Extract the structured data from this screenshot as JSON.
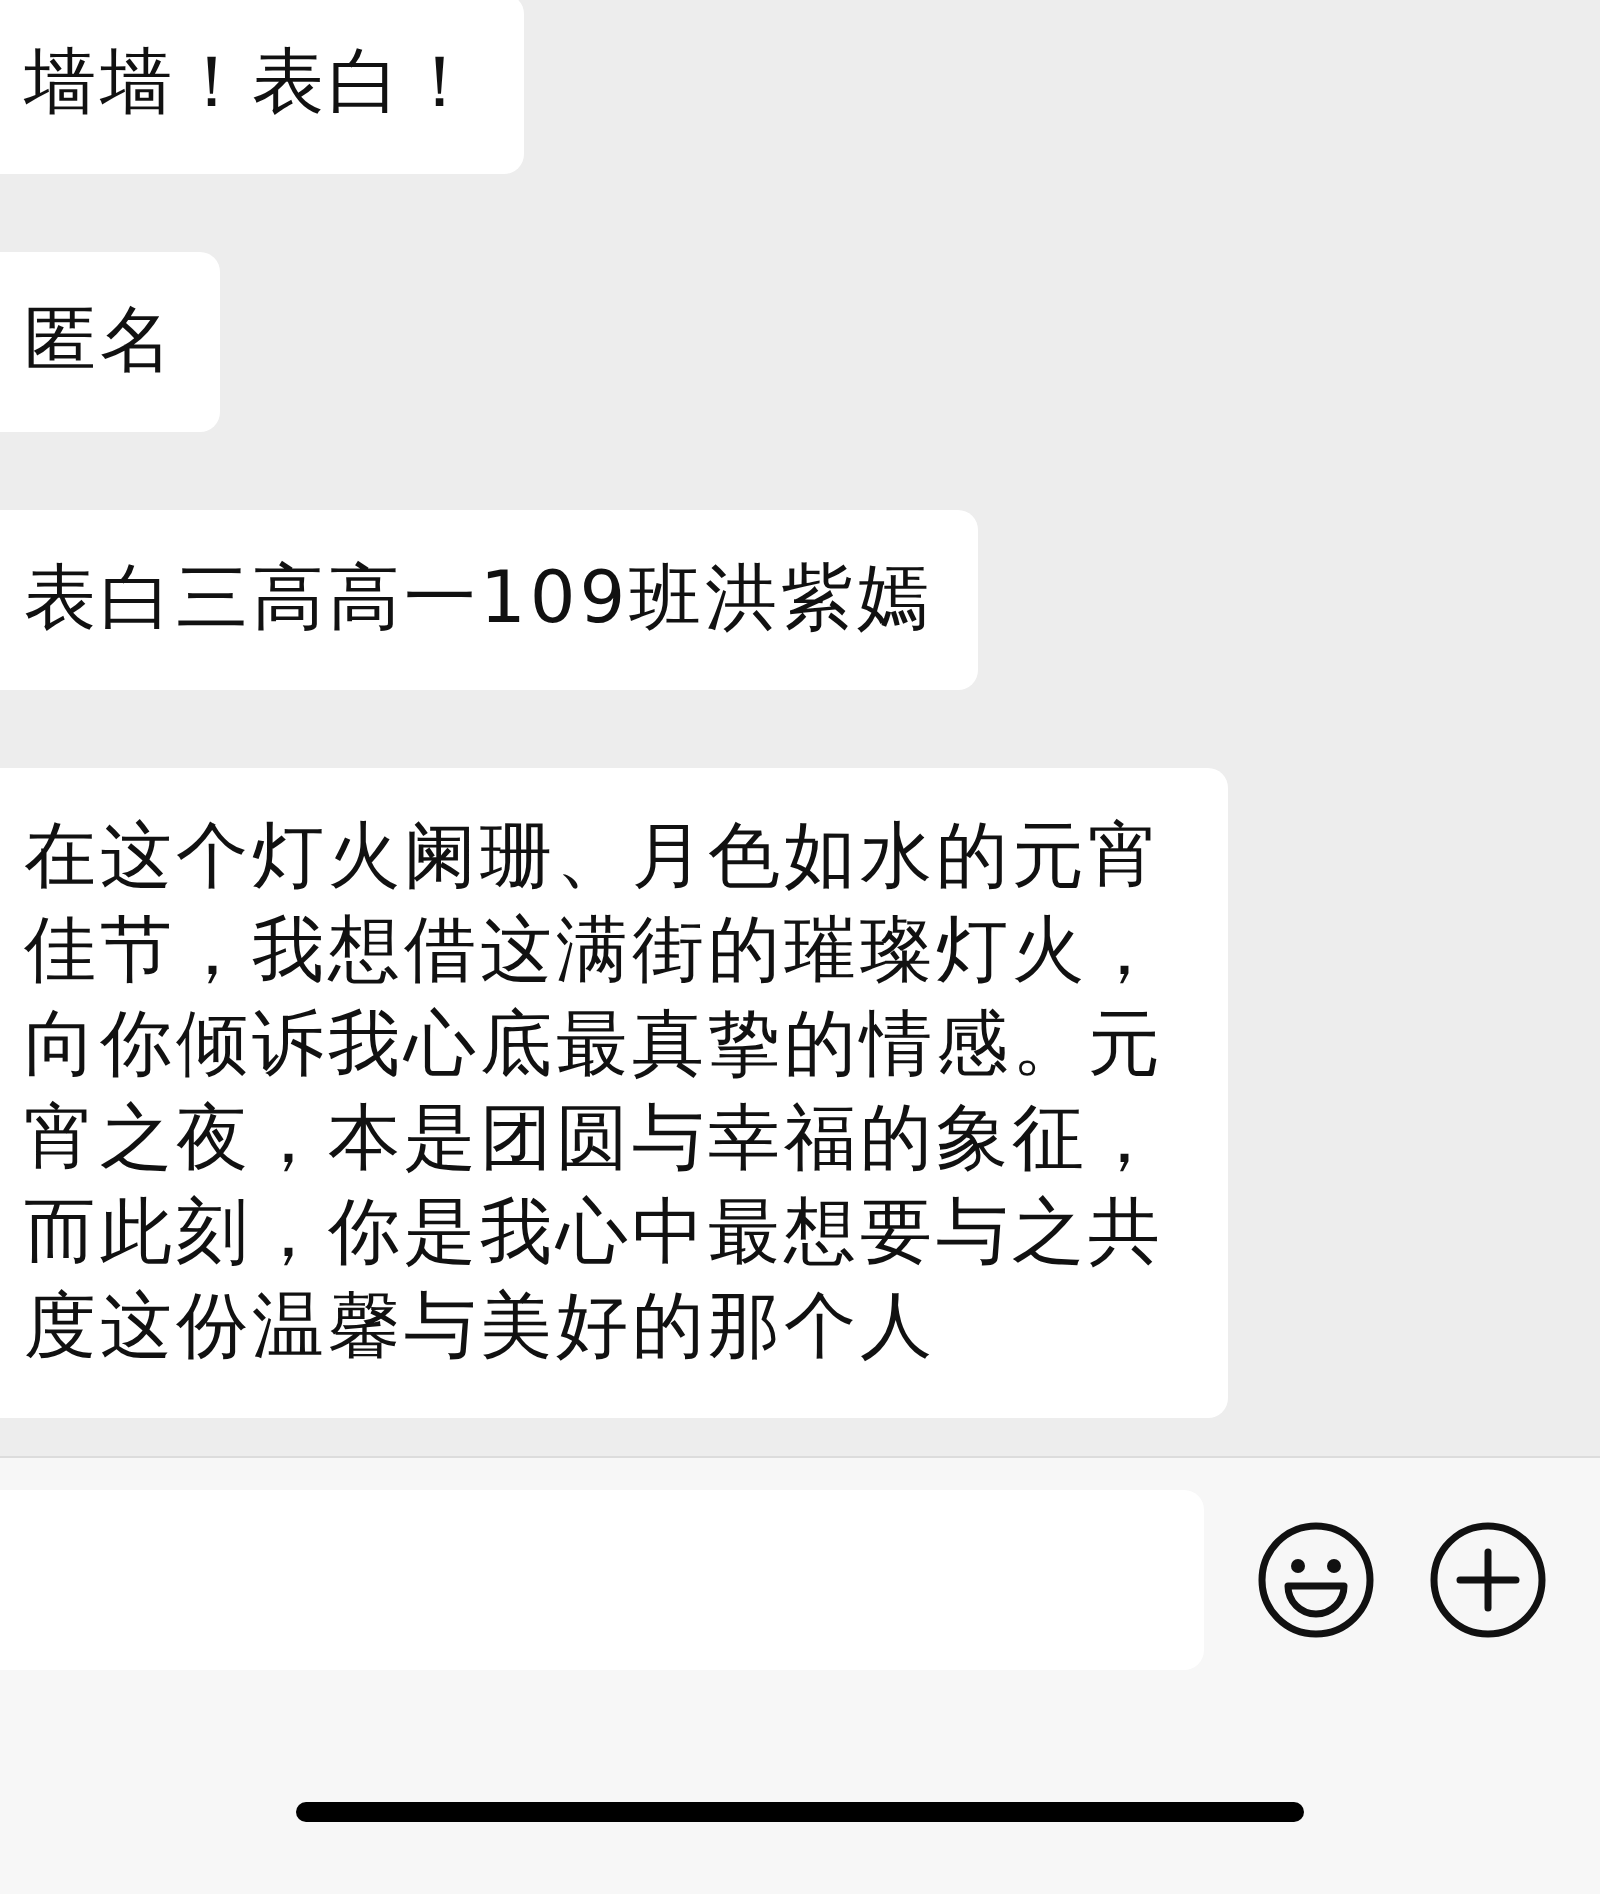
{
  "messages": [
    {
      "text": "墙墙！表白！"
    },
    {
      "text": "匿名"
    },
    {
      "text": "表白三高高一109班洪紫嫣"
    },
    {
      "text": "在这个灯火阑珊、月色如水的元宵佳节，我想借这满街的璀璨灯火，向你倾诉我心底最真挚的情感。元宵之夜，本是团圆与幸福的象征，而此刻，你是我心中最想要与之共度这份温馨与美好的那个人"
    }
  ]
}
